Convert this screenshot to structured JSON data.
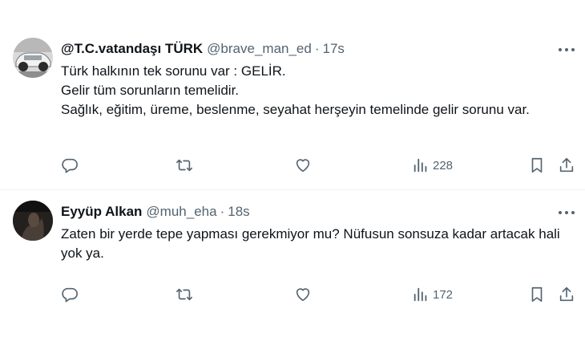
{
  "tweets": [
    {
      "display_name": "@T.C.vatandaşı TÜRK",
      "handle": "@brave_man_ed",
      "separator": "·",
      "time": "17s",
      "lines": [
        "Türk halkının tek sorunu var :  GELİR.",
        "Gelir tüm sorunların temelidir.",
        "Sağlık, eğitim, üreme, beslenme, seyahat herşeyin temelinde gelir sorunu var."
      ],
      "views": "228",
      "avatar_icon": "car-photo-avatar"
    },
    {
      "display_name": "Eyyüp Alkan",
      "handle": "@muh_eha",
      "separator": "·",
      "time": "18s",
      "lines": [
        "Zaten bir yerde tepe yapması gerekmiyor mu? Nüfusun sonsuza kadar artacak hali yok ya."
      ],
      "views": "172",
      "avatar_icon": "dark-photo-avatar"
    }
  ],
  "icons": {
    "reply": "reply-icon",
    "retweet": "retweet-icon",
    "like": "heart-icon",
    "views": "bar-chart-icon",
    "bookmark": "bookmark-icon",
    "share": "share-icon",
    "more": "more-dots-icon"
  },
  "colors": {
    "text": "#0f1419",
    "secondary": "#536471",
    "divider": "#eff3f4"
  }
}
